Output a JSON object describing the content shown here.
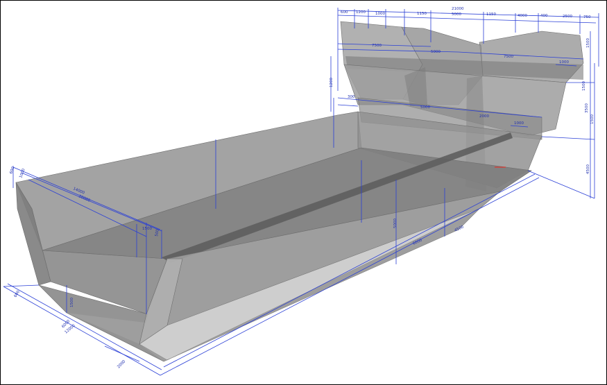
{
  "colors": {
    "background": "#ffffff",
    "dimension_lines": "#2a3fd6",
    "dimension_text": "#1f2fb0",
    "solid_light": "#a9a9a9",
    "solid_mid": "#8f8f8f",
    "solid_dark": "#6d6d6d",
    "axis_marker": "#e0342b"
  },
  "dimensions": {
    "top_total": "21000",
    "top_segments": [
      "600",
      "1200",
      "1000",
      "1150",
      "5000",
      "1150",
      "4000",
      "400",
      "2500",
      "750"
    ],
    "upper_widths": [
      "7500",
      "5000",
      "7500",
      "1000"
    ],
    "mid_widths": [
      "300",
      "5000",
      "2000",
      "1000"
    ],
    "right_heights": [
      "1500",
      "1500",
      "3500",
      "1500",
      "4500"
    ],
    "left_heights": [
      "1200"
    ],
    "front_widths": [
      "600",
      "1000"
    ],
    "long_lengths": [
      "14000",
      "20000"
    ],
    "front_near": [
      "1500",
      "500"
    ],
    "front_depth": "5000",
    "centre_lengths": [
      "6000",
      "4500"
    ],
    "bottom_depth": "1500",
    "bottom_widths": [
      "600",
      "6000",
      "12000",
      "2000"
    ]
  }
}
